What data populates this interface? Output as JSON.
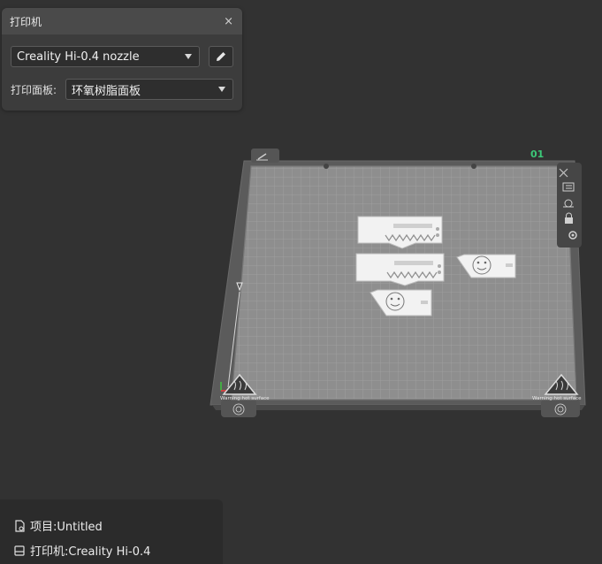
{
  "printer_panel": {
    "title": "打印机",
    "close_symbol": "×",
    "nozzle_selected": "Creality Hi-0.4 nozzle",
    "plate_label": "打印面板:",
    "plate_selected": "环氧树脂面板"
  },
  "plate": {
    "index_label": "01",
    "warning_left": "Warning:hot surface",
    "warning_right": "Warning:hot surface"
  },
  "info": {
    "project": "项目:Untitled",
    "printer": "打印机:Creality Hi-0.4"
  },
  "colors": {
    "background": "#323232",
    "plate_grid": "#9a9a9a",
    "accent_green": "#3cc878"
  },
  "icons": [
    "close-icon",
    "chevron-down-icon",
    "pencil-icon",
    "file-icon",
    "printer-icon",
    "warning-icon",
    "gear-icon",
    "lock-icon",
    "layers-icon"
  ]
}
